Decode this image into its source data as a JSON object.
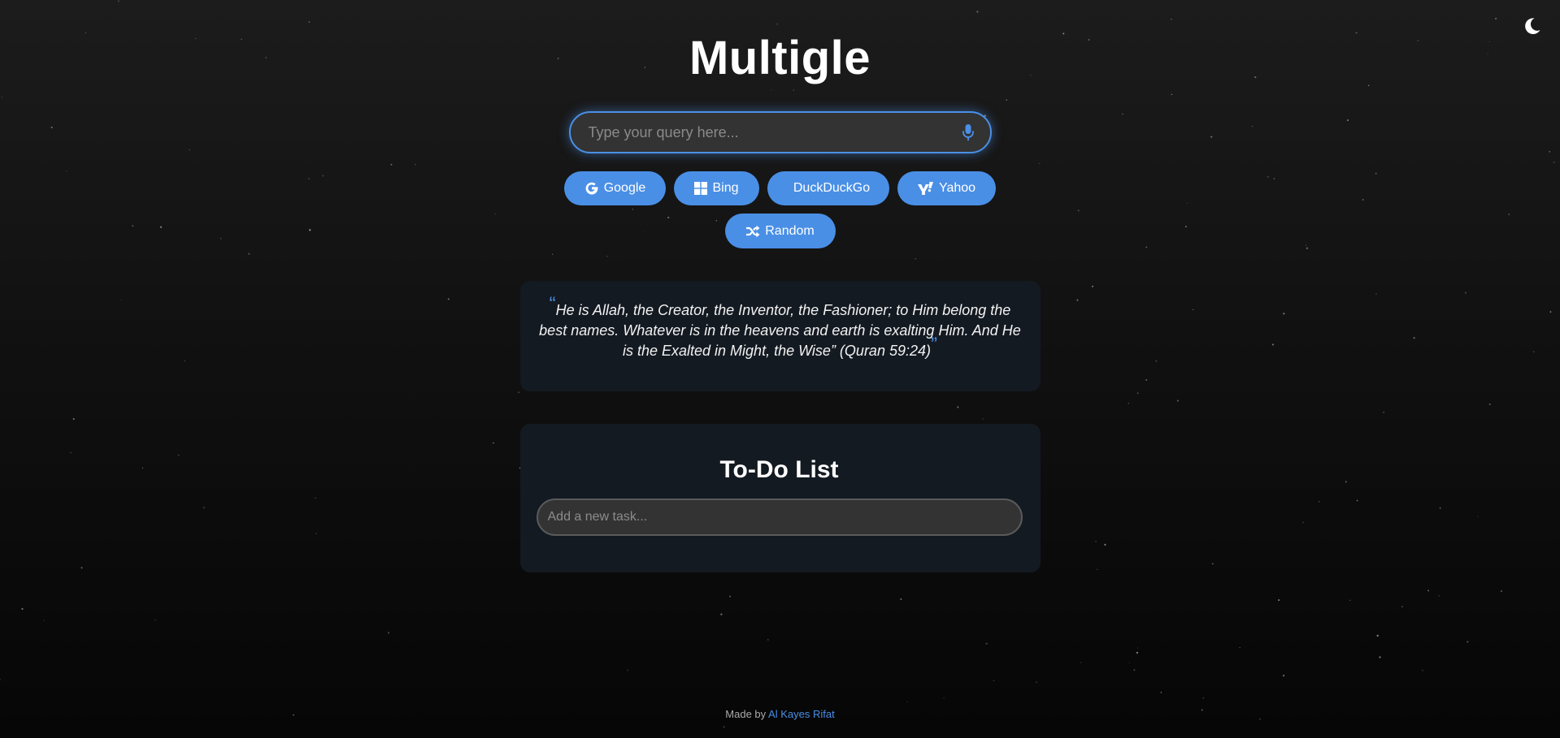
{
  "app": {
    "title": "Multigle",
    "theme_toggle_icon": "moon-icon"
  },
  "search": {
    "placeholder": "Type your query here...",
    "value": "",
    "mic_icon": "microphone-icon"
  },
  "engines": [
    {
      "label": "Google",
      "icon": "google-icon"
    },
    {
      "label": "Bing",
      "icon": "windows-icon"
    },
    {
      "label": "DuckDuckGo",
      "icon": ""
    },
    {
      "label": "Yahoo",
      "icon": "yahoo-icon"
    },
    {
      "label": "Random",
      "icon": "shuffle-icon"
    }
  ],
  "quote": {
    "text": "He is Allah, the Creator, the Inventor, the Fashioner; to Him belong the best names. Whatever is in the heavens and earth is exalting Him. And He is the Exalted in Might, the Wise” (Quran 59:24)",
    "open_mark": "“",
    "close_mark": "”"
  },
  "todo": {
    "title": "To-Do List",
    "placeholder": "Add a new task...",
    "value": ""
  },
  "footer": {
    "prefix": "Made by ",
    "author": "Al Kayes Rifat"
  },
  "colors": {
    "accent": "#4a8fe6",
    "background_top": "#1c1c1c",
    "background_bottom": "#060606",
    "card": "#141a22",
    "input": "#333333"
  }
}
